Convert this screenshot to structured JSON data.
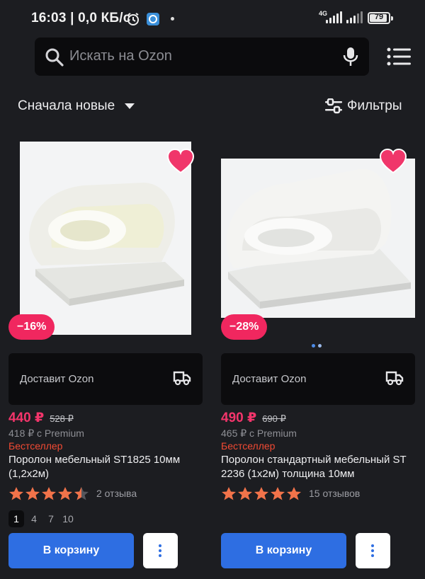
{
  "status_bar": {
    "time": "16:03",
    "data_rate": "0,0 КБ/с",
    "network": "4G",
    "battery": "79"
  },
  "search": {
    "placeholder": "Искать на Ozon"
  },
  "toolbar": {
    "sort_label": "Сначала новые",
    "filters_label": "Фильтры"
  },
  "colors": {
    "background": "#1c1d21",
    "price": "#f3356b",
    "discount_badge": "#f0275f",
    "bestseller": "#f24a33",
    "primary_button": "#2e6ee2",
    "star": "#f2734a"
  },
  "products": [
    {
      "discount": "−16%",
      "delivery": "Доставит Ozon",
      "price": "440 ₽",
      "old_price": "528 ₽",
      "premium_price": "418 ₽ с Premium",
      "badge": "Бестселлер",
      "title": "Поролон мебельный ST1825 10мм (1,2х2м)",
      "rating": 4.5,
      "reviews": "2 отзыва",
      "pages": [
        "1",
        "4",
        "7",
        "10"
      ],
      "cart_label": "В корзину"
    },
    {
      "discount": "−28%",
      "delivery": "Доставит Ozon",
      "price": "490 ₽",
      "old_price": "690 ₽",
      "premium_price": "465 ₽ с Premium",
      "badge": "Бестселлер",
      "title": "Поролон стандартный мебельный ST 2236 (1х2м) толщина 10мм",
      "rating": 5,
      "reviews": "15 отзывов",
      "cart_label": "В корзину"
    }
  ]
}
